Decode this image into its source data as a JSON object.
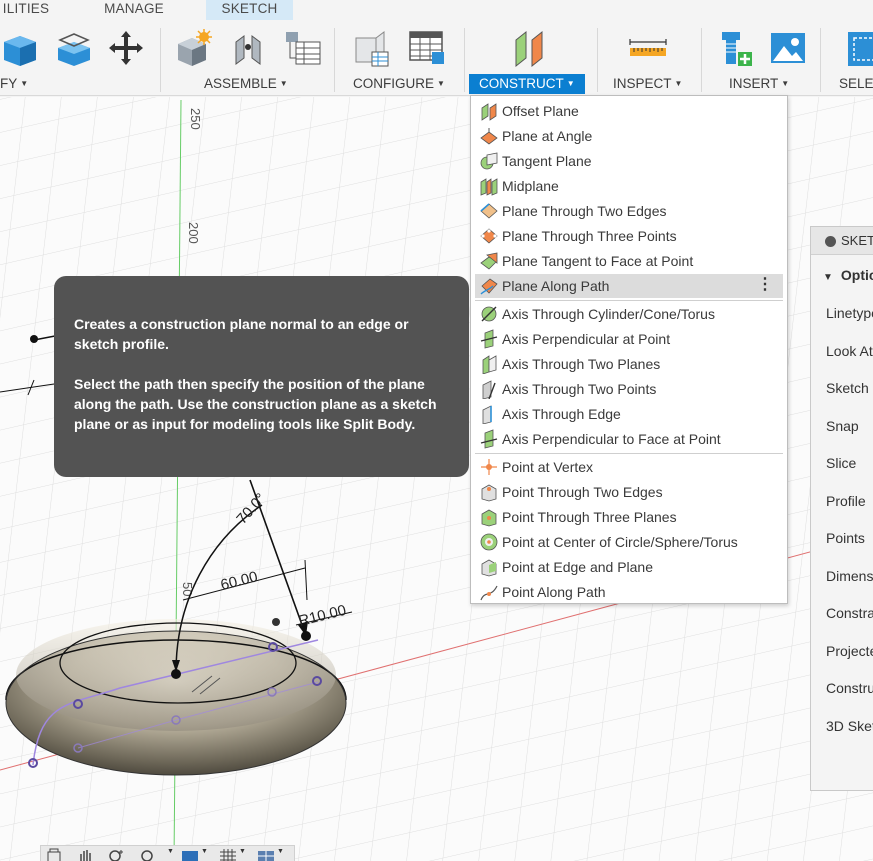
{
  "tabs": [
    {
      "label": "ILITIES",
      "active": false
    },
    {
      "label": "MANAGE",
      "active": false
    },
    {
      "label": "SKETCH",
      "active": true
    }
  ],
  "groups": [
    {
      "label": "FY"
    },
    {
      "label": "ASSEMBLE"
    },
    {
      "label": "CONFIGURE"
    },
    {
      "label": "CONSTRUCT",
      "active": true
    },
    {
      "label": "INSPECT"
    },
    {
      "label": "INSERT"
    },
    {
      "label": "SELE"
    }
  ],
  "toolbar_icons": [
    "box-icon",
    "extrude-icon",
    "move-icon",
    "new-component-icon",
    "joint-icon",
    "table-icon",
    "config-cube-icon",
    "config-table-icon",
    "offset-plane-icon",
    "measure-icon",
    "insert-derive-icon",
    "insert-image-icon",
    "select-icon"
  ],
  "menu": {
    "items": [
      {
        "label": "Offset Plane",
        "icon": "offset-plane-icon"
      },
      {
        "label": "Plane at Angle",
        "icon": "plane-angle-icon"
      },
      {
        "label": "Tangent Plane",
        "icon": "tangent-plane-icon"
      },
      {
        "label": "Midplane",
        "icon": "midplane-icon"
      },
      {
        "label": "Plane Through Two Edges",
        "icon": "plane-two-edges-icon"
      },
      {
        "label": "Plane Through Three Points",
        "icon": "plane-three-points-icon"
      },
      {
        "label": "Plane Tangent to Face at Point",
        "icon": "plane-tangent-face-icon"
      },
      {
        "label": "Plane Along Path",
        "icon": "plane-along-path-icon",
        "hover": true
      },
      {
        "label": "Axis Through Cylinder/Cone/Torus",
        "icon": "axis-cylinder-icon"
      },
      {
        "label": "Axis Perpendicular at Point",
        "icon": "axis-perp-point-icon"
      },
      {
        "label": "Axis Through Two Planes",
        "icon": "axis-two-planes-icon"
      },
      {
        "label": "Axis Through Two Points",
        "icon": "axis-two-points-icon"
      },
      {
        "label": "Axis Through Edge",
        "icon": "axis-edge-icon"
      },
      {
        "label": "Axis Perpendicular to Face at Point",
        "icon": "axis-perp-face-icon"
      },
      {
        "label": "Point at Vertex",
        "icon": "point-vertex-icon"
      },
      {
        "label": "Point Through Two Edges",
        "icon": "point-two-edges-icon"
      },
      {
        "label": "Point Through Three Planes",
        "icon": "point-three-planes-icon"
      },
      {
        "label": "Point at Center of Circle/Sphere/Torus",
        "icon": "point-center-icon"
      },
      {
        "label": "Point at Edge and Plane",
        "icon": "point-edge-plane-icon"
      },
      {
        "label": "Point Along Path",
        "icon": "point-along-path-icon"
      }
    ]
  },
  "tooltip": {
    "para1": "Creates a construction plane normal to an edge or sketch profile.",
    "para2": "Select the path then specify the position of the plane along the path. Use the construction plane as a sketch plane or as input for modeling tools like Split Body."
  },
  "palette": {
    "header": "SKET",
    "section": "Optic",
    "rows": [
      "Linetype",
      "Look At",
      "Sketch",
      "Snap",
      "Slice",
      "Profile",
      "Points",
      "Dimens",
      "Constra",
      "Projecte",
      "Constru",
      "3D Sket"
    ]
  },
  "canvas": {
    "axis_labels": [
      "250",
      "200",
      "50"
    ],
    "dimensions": [
      "70.0°",
      "60.00",
      "R10.00"
    ]
  },
  "colors": {
    "accent": "#0b7fd1",
    "tab_active_bg": "#d5e9f7",
    "tooltip_bg": "#535353",
    "menu_hover": "#dcdcdc",
    "axis_green": "#66cc66",
    "axis_red": "#e07070"
  }
}
